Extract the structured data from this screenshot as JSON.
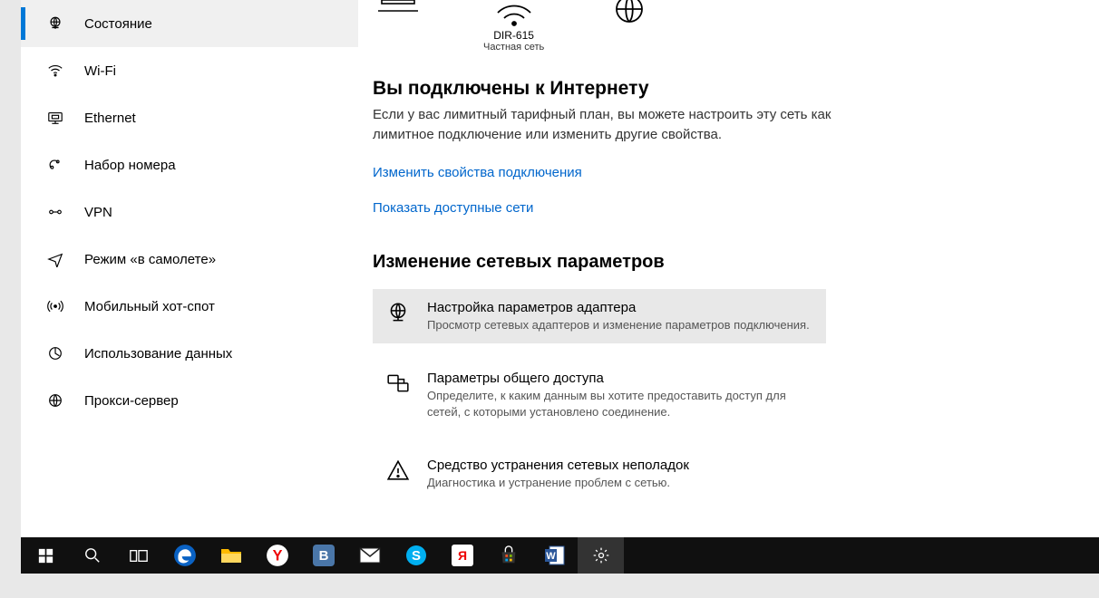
{
  "sidebar": {
    "items": [
      {
        "label": "Состояние",
        "icon": "globe-monitor-icon",
        "selected": true
      },
      {
        "label": "Wi-Fi",
        "icon": "wifi-icon"
      },
      {
        "label": "Ethernet",
        "icon": "ethernet-icon"
      },
      {
        "label": "Набор номера",
        "icon": "dialup-icon"
      },
      {
        "label": "VPN",
        "icon": "vpn-icon"
      },
      {
        "label": "Режим «в самолете»",
        "icon": "airplane-icon"
      },
      {
        "label": "Мобильный хот-спот",
        "icon": "hotspot-icon"
      },
      {
        "label": "Использование данных",
        "icon": "datausage-icon"
      },
      {
        "label": "Прокси-сервер",
        "icon": "proxy-icon"
      }
    ]
  },
  "network": {
    "device_name": "DIR-615",
    "device_type": "Частная сеть"
  },
  "status": {
    "heading": "Вы подключены к Интернету",
    "description": "Если у вас лимитный тарифный план, вы можете настроить эту сеть как лимитное подключение или изменить другие свойства.",
    "link_props": "Изменить свойства подключения",
    "link_networks": "Показать доступные сети"
  },
  "change": {
    "heading": "Изменение сетевых параметров",
    "options": [
      {
        "title": "Настройка параметров адаптера",
        "desc": "Просмотр сетевых адаптеров и изменение параметров подключения.",
        "icon": "adapter-icon",
        "hover": true
      },
      {
        "title": "Параметры общего доступа",
        "desc": "Определите, к каким данным вы хотите предоставить доступ для сетей, с которыми установлено соединение.",
        "icon": "sharing-icon"
      },
      {
        "title": "Средство устранения сетевых неполадок",
        "desc": "Диагностика и устранение проблем с сетью.",
        "icon": "troubleshoot-icon"
      }
    ]
  },
  "taskbar": {
    "items": [
      {
        "name": "start-button",
        "icon": "windows-icon"
      },
      {
        "name": "search-button",
        "icon": "search-icon"
      },
      {
        "name": "taskview-button",
        "icon": "taskview-icon"
      },
      {
        "name": "edge-app",
        "icon": "edge-icon"
      },
      {
        "name": "explorer-app",
        "icon": "folder-icon"
      },
      {
        "name": "yandex-app",
        "icon": "yandex-icon"
      },
      {
        "name": "vk-app",
        "icon": "vk-icon"
      },
      {
        "name": "mail-app",
        "icon": "mail-icon"
      },
      {
        "name": "skype-app",
        "icon": "skype-icon"
      },
      {
        "name": "yandex-search-app",
        "icon": "yandex-white-icon"
      },
      {
        "name": "store-app",
        "icon": "store-icon"
      },
      {
        "name": "word-app",
        "icon": "word-icon"
      },
      {
        "name": "settings-app",
        "icon": "gear-icon",
        "active": true
      }
    ]
  }
}
